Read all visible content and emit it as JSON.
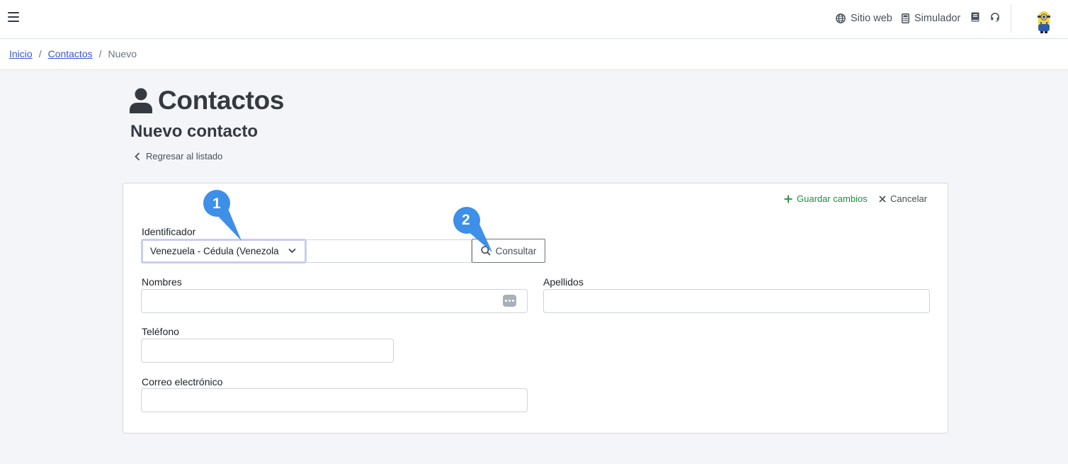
{
  "topbar": {
    "website_label": "Sitio web",
    "simulator_label": "Simulador"
  },
  "breadcrumb": {
    "home": "Inicio",
    "contacts": "Contactos",
    "current": "Nuevo",
    "separator": "/"
  },
  "page": {
    "title": "Contactos",
    "subtitle": "Nuevo contacto",
    "back_label": "Regresar al listado"
  },
  "card": {
    "save_label": "Guardar cambios",
    "cancel_label": "Cancelar",
    "identifier": {
      "label": "Identificador",
      "selected_type": "Venezuela - Cédula (Venezola",
      "value": "",
      "consult_label": "Consultar"
    },
    "names_label": "Nombres",
    "last_names_label": "Apellidos",
    "phone_label": "Teléfono",
    "email_label": "Correo electrónico"
  },
  "callouts": [
    "1",
    "2"
  ],
  "colors": {
    "accent": "#3b58c9",
    "save": "#1e8e3e",
    "callout": "#3d8fe8",
    "background": "#f4f5f9"
  },
  "icons": {
    "menu": "hamburger-icon",
    "website": "globe-icon",
    "simulator": "calculator-icon",
    "manual": "book-icon",
    "support": "headset-icon",
    "title": "user-icon",
    "back": "chevron-left-icon",
    "save": "plus-icon",
    "cancel": "close-icon",
    "select": "chevron-down-icon",
    "consult": "search-icon",
    "names_action": "dots-icon"
  }
}
